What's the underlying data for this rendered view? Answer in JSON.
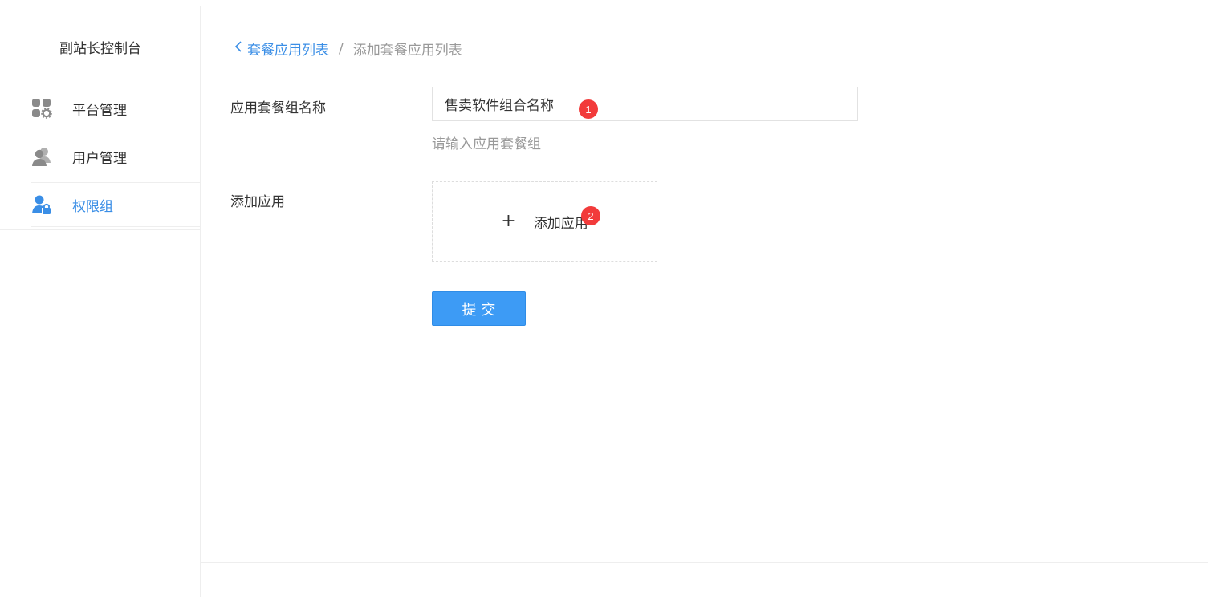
{
  "sidebar": {
    "title": "副站长控制台",
    "items": [
      {
        "label": "平台管理",
        "icon": "apps-gear-icon",
        "active": false
      },
      {
        "label": "用户管理",
        "icon": "users-icon",
        "active": false
      },
      {
        "label": "权限组",
        "icon": "user-lock-icon",
        "active": true
      }
    ]
  },
  "breadcrumb": {
    "back_label": "套餐应用列表",
    "separator": "/",
    "current": "添加套餐应用列表"
  },
  "form": {
    "name_label": "应用套餐组名称",
    "name_value": "售卖软件组合名称",
    "name_hint": "请输入应用套餐组",
    "add_app_label": "添加应用",
    "add_app_button": "添加应用",
    "plus_symbol": "+",
    "submit_label": "提交"
  },
  "annotations": {
    "badge_1": "1",
    "badge_2": "2"
  },
  "colors": {
    "accent": "#3a8ee6",
    "button_bg": "#3d9bf5",
    "badge": "#f23b3b",
    "muted_text": "#999999",
    "icon_gray": "#8a8a8a"
  }
}
